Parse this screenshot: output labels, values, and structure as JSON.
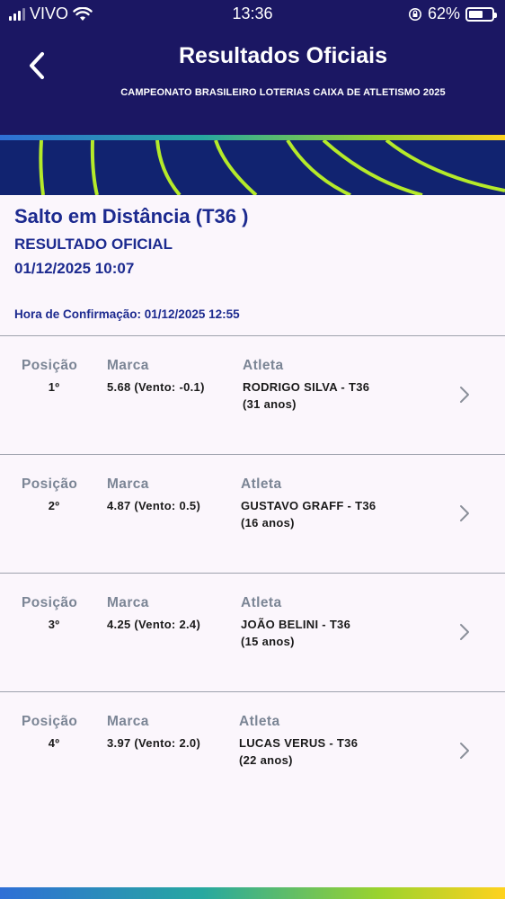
{
  "status_bar": {
    "carrier": "VIVO",
    "time": "13:36",
    "battery": "62%"
  },
  "header": {
    "title": "Resultados Oficiais",
    "subtitle": "CAMPEONATO BRASILEIRO LOTERIAS CAIXA DE ATLETISMO 2025",
    "background_color": "#1b1763"
  },
  "event": {
    "name": "Salto em Distância (T36 )",
    "status": "RESULTADO OFICIAL",
    "datetime": "01/12/2025 10:07",
    "confirmation": "Hora de Confirmação: 01/12/2025 12:55"
  },
  "columns": {
    "position": "Posição",
    "mark": "Marca",
    "athlete": "Atleta"
  },
  "results": [
    {
      "position": "1º",
      "mark": "5.68 (Vento: -0.1)",
      "athlete": "RODRIGO SILVA - T36",
      "age": "(31 anos)"
    },
    {
      "position": "2º",
      "mark": "4.87 (Vento: 0.5)",
      "athlete": "GUSTAVO GRAFF - T36",
      "age": "(16 anos)"
    },
    {
      "position": "3º",
      "mark": "4.25 (Vento: 2.4)",
      "athlete": "JOÃO BELINI - T36",
      "age": "(15 anos)"
    },
    {
      "position": "4º",
      "mark": "3.97 (Vento: 2.0)",
      "athlete": "LUCAS VERUS - T36",
      "age": "(22 anos)"
    }
  ],
  "colors": {
    "accent_text": "#1c2a8f",
    "label_gray": "#7b8595",
    "banner_green": "#b5ea2a"
  }
}
